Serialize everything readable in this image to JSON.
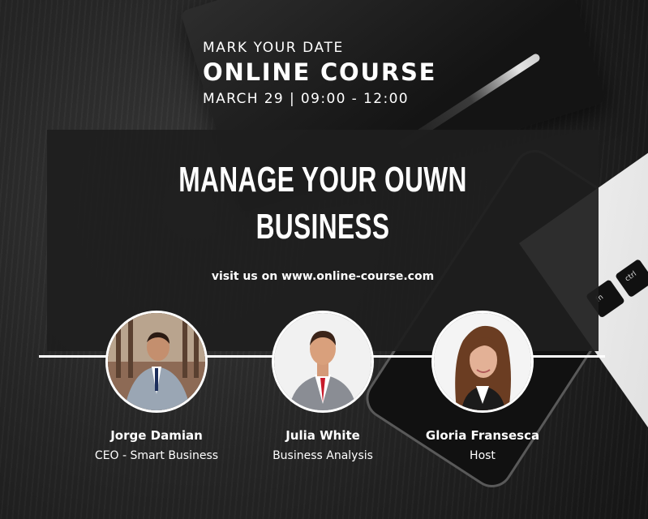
{
  "header": {
    "pre_title": "MARK YOUR DATE",
    "title": "ONLINE COURSE",
    "date_time": "MARCH 29 | 09:00 - 12:00"
  },
  "main": {
    "headline_line1": "MANAGE YOUR OUWN",
    "headline_line2": "BUSINESS",
    "website": "visit us on www.online-course.com"
  },
  "speakers": [
    {
      "name": "Jorge Damian",
      "role": "CEO - Smart Business"
    },
    {
      "name": "Julia White",
      "role": "Business Analysis"
    },
    {
      "name": "Gloria Fransesca",
      "role": "Host"
    }
  ],
  "laptop_keys": [
    "fn",
    "ctrl"
  ],
  "colors": {
    "panel": "#1e1e1e",
    "text": "#ffffff",
    "background": "#262626"
  }
}
